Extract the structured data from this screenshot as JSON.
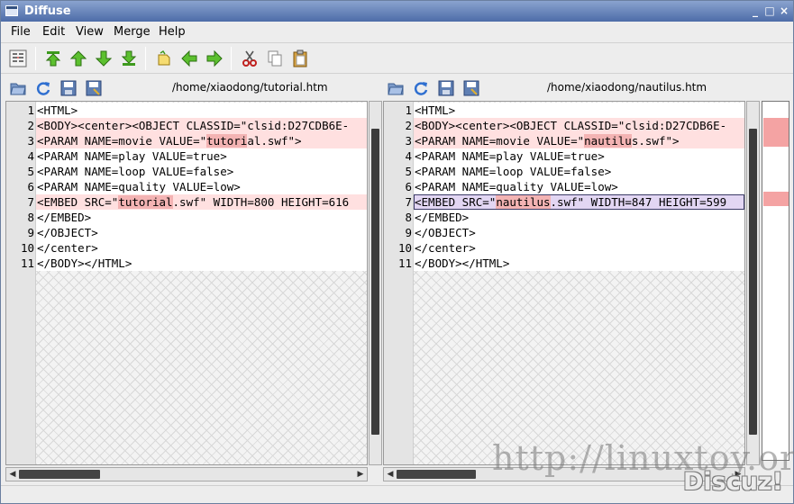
{
  "window": {
    "title": "Diffuse",
    "minimize": "_",
    "maximize": "□",
    "close": "×"
  },
  "menu": [
    {
      "label": "File"
    },
    {
      "label": "Edit"
    },
    {
      "label": "View"
    },
    {
      "label": "Merge"
    },
    {
      "label": "Help"
    }
  ],
  "left": {
    "path": "/home/xiaodong/tutorial.htm",
    "lines": [
      {
        "num": "1",
        "pre": "<HTML>",
        "diff": "",
        "post": "",
        "state": "normal"
      },
      {
        "num": "2",
        "pre": "<BODY><center><OBJECT CLASSID=\"clsid:D27CDB6E-",
        "diff": "",
        "post": "",
        "state": "changed"
      },
      {
        "num": "3",
        "pre": "<PARAM NAME=movie VALUE=\"",
        "diff": "tutori",
        "post": "al.swf\">",
        "state": "changed"
      },
      {
        "num": "4",
        "pre": "<PARAM NAME=play VALUE=true>",
        "diff": "",
        "post": "",
        "state": "normal"
      },
      {
        "num": "5",
        "pre": "<PARAM NAME=loop VALUE=false>",
        "diff": "",
        "post": "",
        "state": "normal"
      },
      {
        "num": "6",
        "pre": "<PARAM NAME=quality VALUE=low>",
        "diff": "",
        "post": "",
        "state": "normal"
      },
      {
        "num": "7",
        "pre": "<EMBED SRC=\"",
        "diff": "tutorial",
        "post": ".swf\" WIDTH=800 HEIGHT=616",
        "state": "changed"
      },
      {
        "num": "8",
        "pre": "</EMBED>",
        "diff": "",
        "post": "",
        "state": "normal"
      },
      {
        "num": "9",
        "pre": "</OBJECT>",
        "diff": "",
        "post": "",
        "state": "normal"
      },
      {
        "num": "10",
        "pre": "</center>",
        "diff": "",
        "post": "",
        "state": "normal"
      },
      {
        "num": "11",
        "pre": "</BODY></HTML>",
        "diff": "",
        "post": "",
        "state": "normal"
      }
    ]
  },
  "right": {
    "path": "/home/xiaodong/nautilus.htm",
    "lines": [
      {
        "num": "1",
        "pre": "<HTML>",
        "diff": "",
        "post": "",
        "state": "normal"
      },
      {
        "num": "2",
        "pre": "<BODY><center><OBJECT CLASSID=\"clsid:D27CDB6E-",
        "diff": "",
        "post": "",
        "state": "changed"
      },
      {
        "num": "3",
        "pre": "<PARAM NAME=movie VALUE=\"",
        "diff": "nautilu",
        "post": "s.swf\">",
        "state": "changed"
      },
      {
        "num": "4",
        "pre": "<PARAM NAME=play VALUE=true>",
        "diff": "",
        "post": "",
        "state": "normal"
      },
      {
        "num": "5",
        "pre": "<PARAM NAME=loop VALUE=false>",
        "diff": "",
        "post": "",
        "state": "normal"
      },
      {
        "num": "6",
        "pre": "<PARAM NAME=quality VALUE=low>",
        "diff": "",
        "post": "",
        "state": "normal"
      },
      {
        "num": "7",
        "pre": "<EMBED SRC=\"",
        "diff": "nautilus",
        "post": ".swf\" WIDTH=847 HEIGHT=599",
        "state": "selected"
      },
      {
        "num": "8",
        "pre": "</EMBED>",
        "diff": "",
        "post": "",
        "state": "normal"
      },
      {
        "num": "9",
        "pre": "</OBJECT>",
        "diff": "",
        "post": "",
        "state": "normal"
      },
      {
        "num": "10",
        "pre": "</center>",
        "diff": "",
        "post": "",
        "state": "normal"
      },
      {
        "num": "11",
        "pre": "</BODY></HTML>",
        "diff": "",
        "post": "",
        "state": "normal"
      }
    ]
  },
  "overview_marks": [
    {
      "line": 2
    },
    {
      "line": 3
    },
    {
      "line": 7
    }
  ],
  "colors": {
    "changed_line": "#ffe0e0",
    "changed_text": "#f3b3b3",
    "selected_line": "#e2d6f3",
    "titlebar": "#5a77b0"
  },
  "watermark": {
    "url": "http://linuxtoy.org",
    "brand": "Discuz!"
  }
}
